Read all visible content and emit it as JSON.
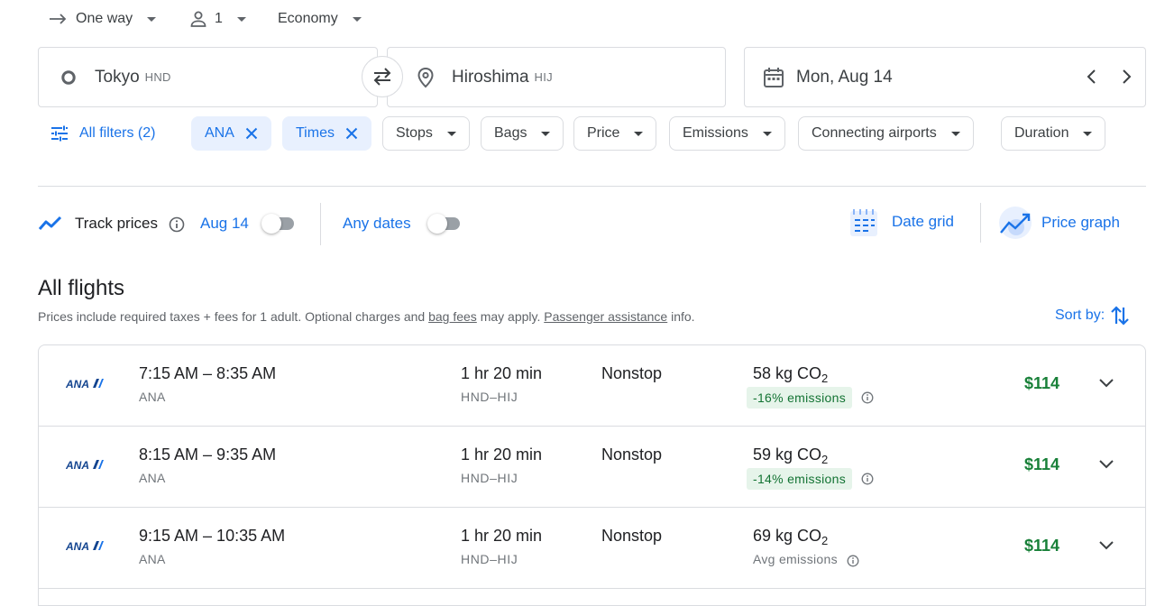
{
  "trip": {
    "type_label": "One way",
    "passengers": "1",
    "cabin": "Economy"
  },
  "search": {
    "origin": {
      "city": "Tokyo",
      "code": "HND"
    },
    "destination": {
      "city": "Hiroshima",
      "code": "HIJ"
    },
    "date": "Mon, Aug 14"
  },
  "filters": {
    "all_filters_label": "All filters (2)",
    "active_chips": [
      "ANA",
      "Times"
    ],
    "chips": [
      "Stops",
      "Bags",
      "Price",
      "Emissions",
      "Connecting airports",
      "Duration"
    ]
  },
  "track": {
    "label": "Track prices",
    "date_label": "Aug 14",
    "any_dates_label": "Any dates",
    "date_grid_label": "Date grid",
    "price_graph_label": "Price graph"
  },
  "results": {
    "title": "All flights",
    "note_prefix": "Prices include required taxes + fees for 1 adult. Optional charges and ",
    "bag_fees_link": "bag fees",
    "note_mid": " may apply. ",
    "assistance_link": "Passenger assistance",
    "note_suffix": " info.",
    "sort_label": "Sort by:"
  },
  "flights": [
    {
      "times": "7:15 AM – 8:35 AM",
      "airline": "ANA",
      "duration": "1 hr 20 min",
      "route": "HND–HIJ",
      "stops": "Nonstop",
      "co2_value": "58 kg CO",
      "co2_sub": "2",
      "emissions": "-16% emissions",
      "price": "$114"
    },
    {
      "times": "8:15 AM – 9:35 AM",
      "airline": "ANA",
      "duration": "1 hr 20 min",
      "route": "HND–HIJ",
      "stops": "Nonstop",
      "co2_value": "59 kg CO",
      "co2_sub": "2",
      "emissions": "-14% emissions",
      "price": "$114"
    },
    {
      "times": "9:15 AM – 10:35 AM",
      "airline": "ANA",
      "duration": "1 hr 20 min",
      "route": "HND–HIJ",
      "stops": "Nonstop",
      "co2_value": "69 kg CO",
      "co2_sub": "2",
      "emissions": "Avg emissions",
      "price": "$114"
    }
  ],
  "colors": {
    "accent": "#1a73e8",
    "price": "#188038",
    "eco_bg": "#e6f4ea",
    "eco_text": "#137333",
    "ana_blue": "#13448f"
  }
}
